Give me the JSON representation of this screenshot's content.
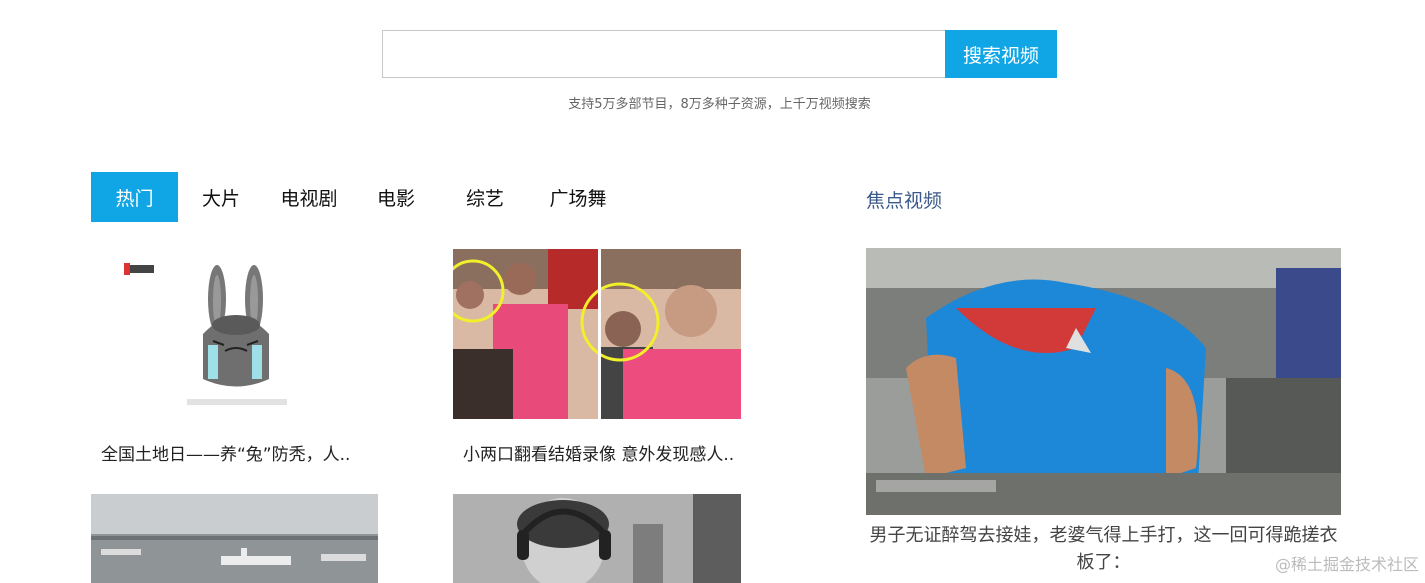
{
  "search": {
    "value": "",
    "placeholder": "",
    "button_label": "搜索视频",
    "hint": "支持5万多部节目，8万多种子资源，上千万视频搜索"
  },
  "tabs": [
    {
      "label": "热门",
      "active": true
    },
    {
      "label": "大片",
      "active": false
    },
    {
      "label": "电视剧",
      "active": false
    },
    {
      "label": "电影",
      "active": false
    },
    {
      "label": "综艺",
      "active": false
    },
    {
      "label": "广场舞",
      "active": false
    }
  ],
  "focus": {
    "title": "焦点视频",
    "caption": "男子无证醉驾去接娃，老婆气得上手打，这一回可得跪搓衣板了：",
    "thumb_icon": "man-in-blue-shirt-cctv-thumbnail"
  },
  "videos": [
    {
      "title": "全国土地日——养“兔”防秃，人..",
      "thumb_icon": "crying-rabbit-thumbnail",
      "thumb_text": "梨视频"
    },
    {
      "title": "小两口翻看结婚录像 意外发现感人..",
      "thumb_icon": "wedding-video-thumbnail"
    },
    {
      "title": "",
      "thumb_icon": "airport-planes-thumbnail"
    },
    {
      "title": "",
      "thumb_icon": "woman-with-headphones-thumbnail"
    }
  ],
  "watermark": "@稀土掘金技术社区",
  "colors": {
    "accent": "#10a6e6",
    "focus_title": "#3b5a8a"
  }
}
